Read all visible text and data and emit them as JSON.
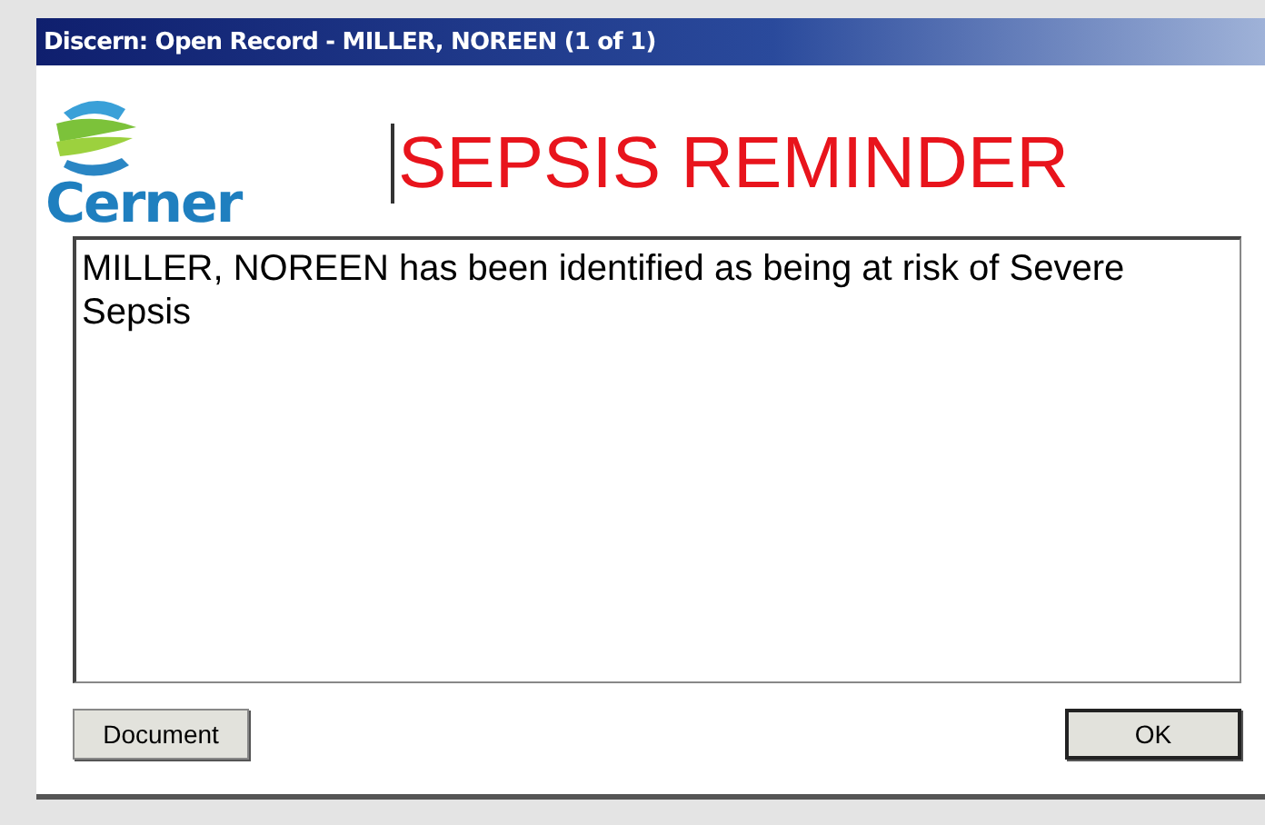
{
  "window": {
    "title": "Discern: Open Record - MILLER, NOREEN (1 of 1)"
  },
  "logo": {
    "text": "Cerner"
  },
  "heading": "SEPSIS REMINDER",
  "message": "MILLER, NOREEN has been identified as being at risk of Severe Sepsis",
  "buttons": [
    {
      "label": "Document",
      "default": false
    },
    {
      "label": "OK",
      "default": true
    }
  ]
}
